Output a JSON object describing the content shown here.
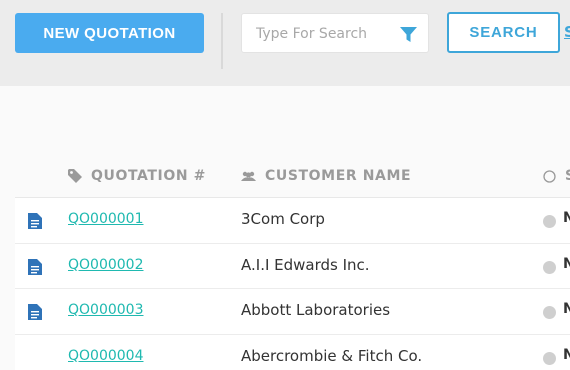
{
  "toolbar": {
    "new_quotation_label": "NEW QUOTATION",
    "search_placeholder": "Type For Search",
    "search_button_label": "SEARCH",
    "cut_link_label": "S"
  },
  "colors": {
    "primary_button": "#4aabef",
    "accent": "#3ea6d9",
    "link": "#1fb9b0",
    "doc_icon": "#2f73b8",
    "status_dot": "#cfcfcf"
  },
  "table": {
    "headers": {
      "quotation": "QUOTATION #",
      "customer": "CUSTOMER NAME",
      "status_cut": "S"
    },
    "rows": [
      {
        "quotation": "QO000001",
        "customer": "3Com Corp",
        "status_cut": "N",
        "has_doc_icon": true
      },
      {
        "quotation": "QO000002",
        "customer": "A.I.I Edwards Inc.",
        "status_cut": "N",
        "has_doc_icon": true
      },
      {
        "quotation": "QO000003",
        "customer": "Abbott Laboratories",
        "status_cut": "N",
        "has_doc_icon": true
      },
      {
        "quotation": "QO000004",
        "customer": "Abercrombie & Fitch Co.",
        "status_cut": "N",
        "has_doc_icon": false
      }
    ]
  },
  "icons": {
    "filter": "filter-icon",
    "tag": "tag-icon",
    "users": "users-icon",
    "status": "circle-icon",
    "document": "document-icon"
  }
}
